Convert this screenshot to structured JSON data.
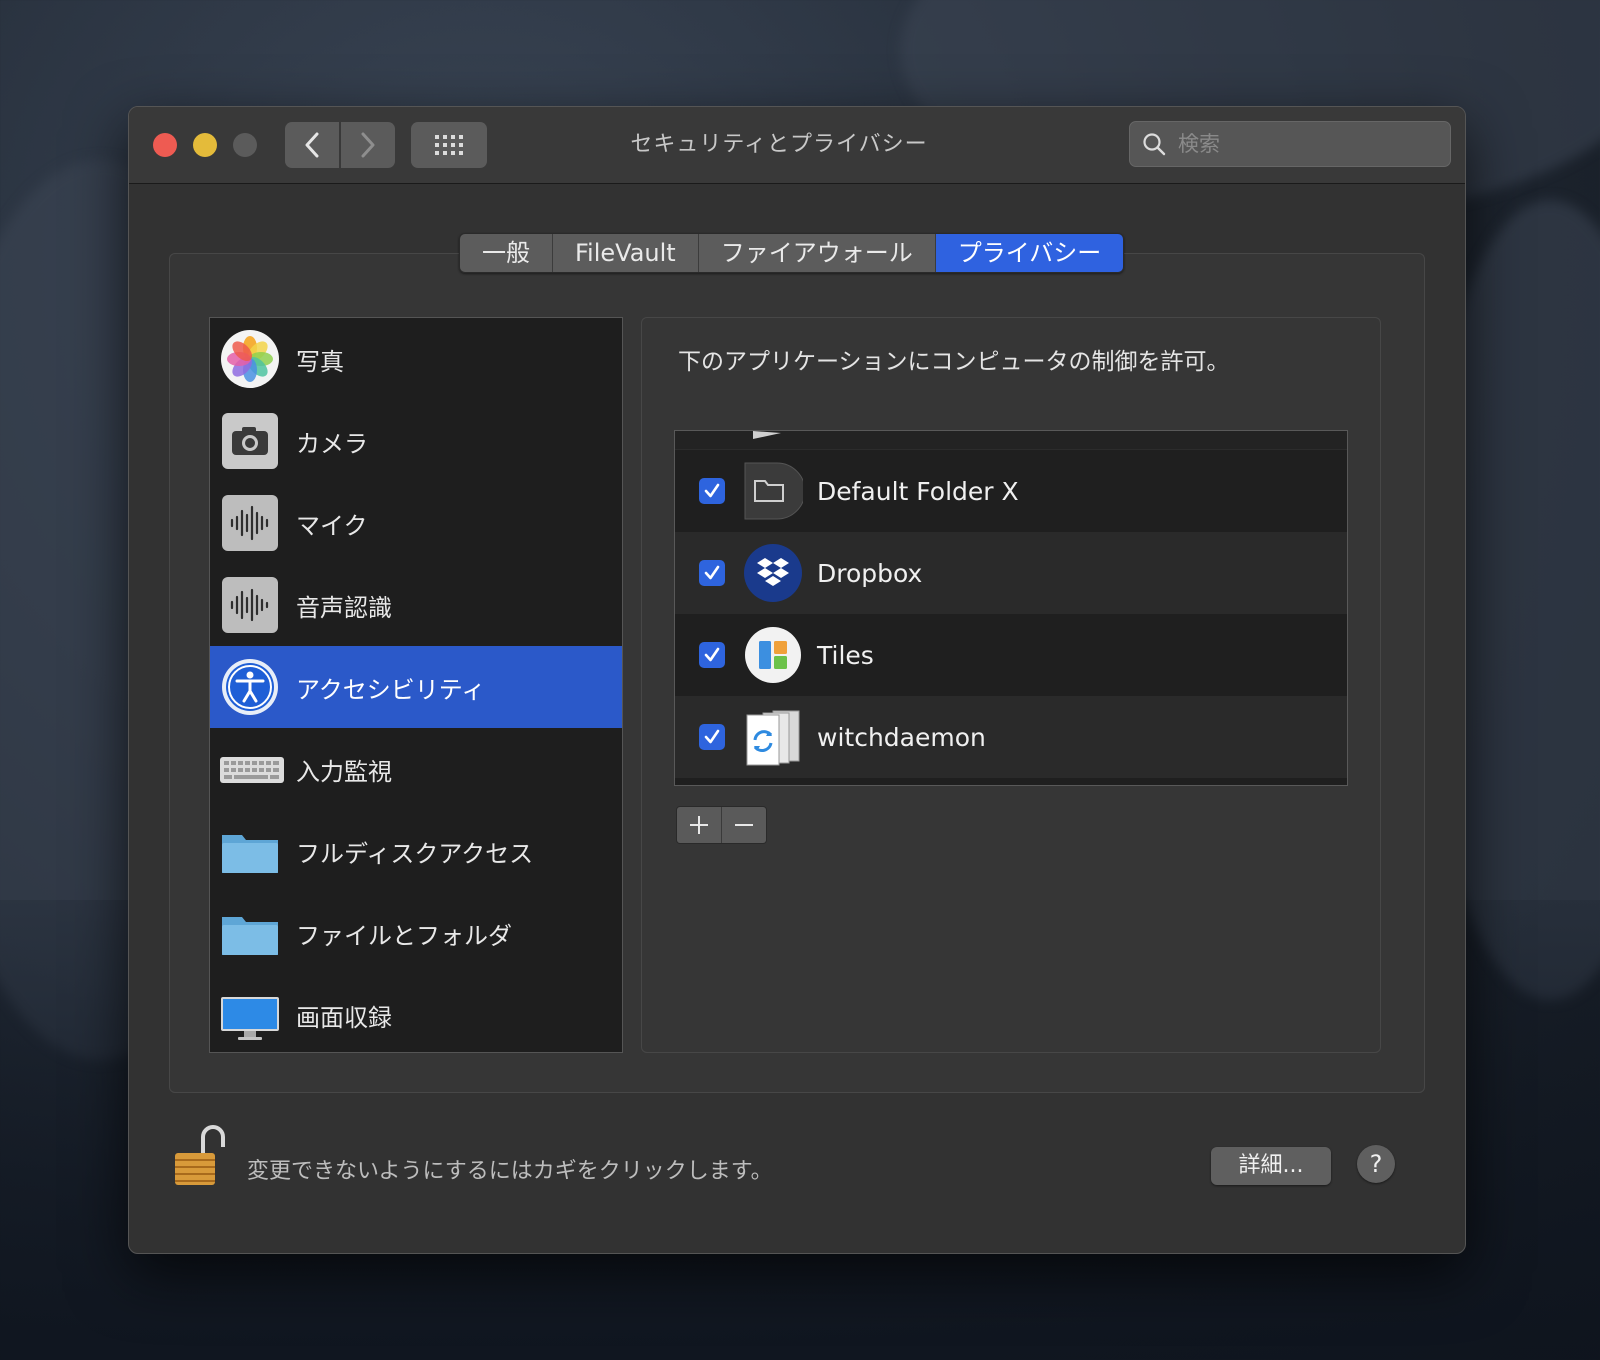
{
  "window": {
    "title": "セキュリティとプライバシー",
    "search_placeholder": "検索"
  },
  "tabs": [
    {
      "label": "一般",
      "active": false
    },
    {
      "label": "FileVault",
      "active": false
    },
    {
      "label": "ファイアウォール",
      "active": false
    },
    {
      "label": "プライバシー",
      "active": true
    }
  ],
  "sidebar": {
    "items": [
      {
        "label": "写真",
        "icon": "photos-icon"
      },
      {
        "label": "カメラ",
        "icon": "camera-icon"
      },
      {
        "label": "マイク",
        "icon": "microphone-waveform-icon"
      },
      {
        "label": "音声認識",
        "icon": "speech-recognition-waveform-icon"
      },
      {
        "label": "アクセシビリティ",
        "icon": "accessibility-icon",
        "selected": true
      },
      {
        "label": "入力監視",
        "icon": "keyboard-icon"
      },
      {
        "label": "フルディスクアクセス",
        "icon": "folder-icon"
      },
      {
        "label": "ファイルとフォルダ",
        "icon": "folder-icon"
      },
      {
        "label": "画面収録",
        "icon": "display-icon"
      }
    ]
  },
  "main": {
    "instruction": "下のアプリケーションにコンピュータの制御を許可。",
    "apps": [
      {
        "name": "Default Folder X",
        "checked": true,
        "icon": "default-folder-x-icon"
      },
      {
        "name": "Dropbox",
        "checked": true,
        "icon": "dropbox-icon"
      },
      {
        "name": "Tiles",
        "checked": true,
        "icon": "tiles-icon"
      },
      {
        "name": "witchdaemon",
        "checked": true,
        "icon": "witch-icon"
      }
    ],
    "add_label": "+",
    "remove_label": "−"
  },
  "footer": {
    "lock_text": "変更できないようにするにはカギをクリックします。",
    "details_label": "詳細...",
    "help_label": "?"
  },
  "colors": {
    "accent": "#2f62e0",
    "selection": "#2b59c9",
    "close": "#ee5b52",
    "minimize": "#e4bb3a"
  }
}
